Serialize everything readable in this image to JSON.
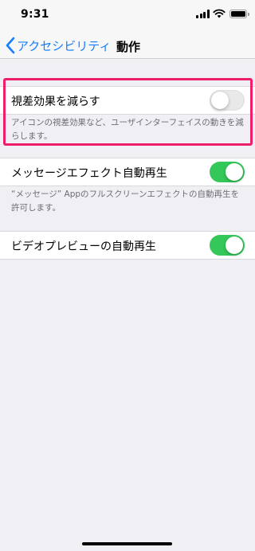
{
  "status": {
    "time": "9:31"
  },
  "nav": {
    "back_label": "アクセシビリティ",
    "title": "動作"
  },
  "settings": [
    {
      "label": "視差効果を減らす",
      "toggle_on": false,
      "footer": "アイコンの視差効果など、ユーザインターフェイスの動きを減らします。"
    },
    {
      "label": "メッセージエフェクト自動再生",
      "toggle_on": true,
      "footer": "“メッセージ” Appのフルスクリーンエフェクトの自動再生を許可します。"
    },
    {
      "label": "ビデオプレビューの自動再生",
      "toggle_on": true
    }
  ],
  "colors": {
    "accent": "#147efb",
    "toggle_on": "#34c759",
    "highlight": "#ef1e6b"
  }
}
